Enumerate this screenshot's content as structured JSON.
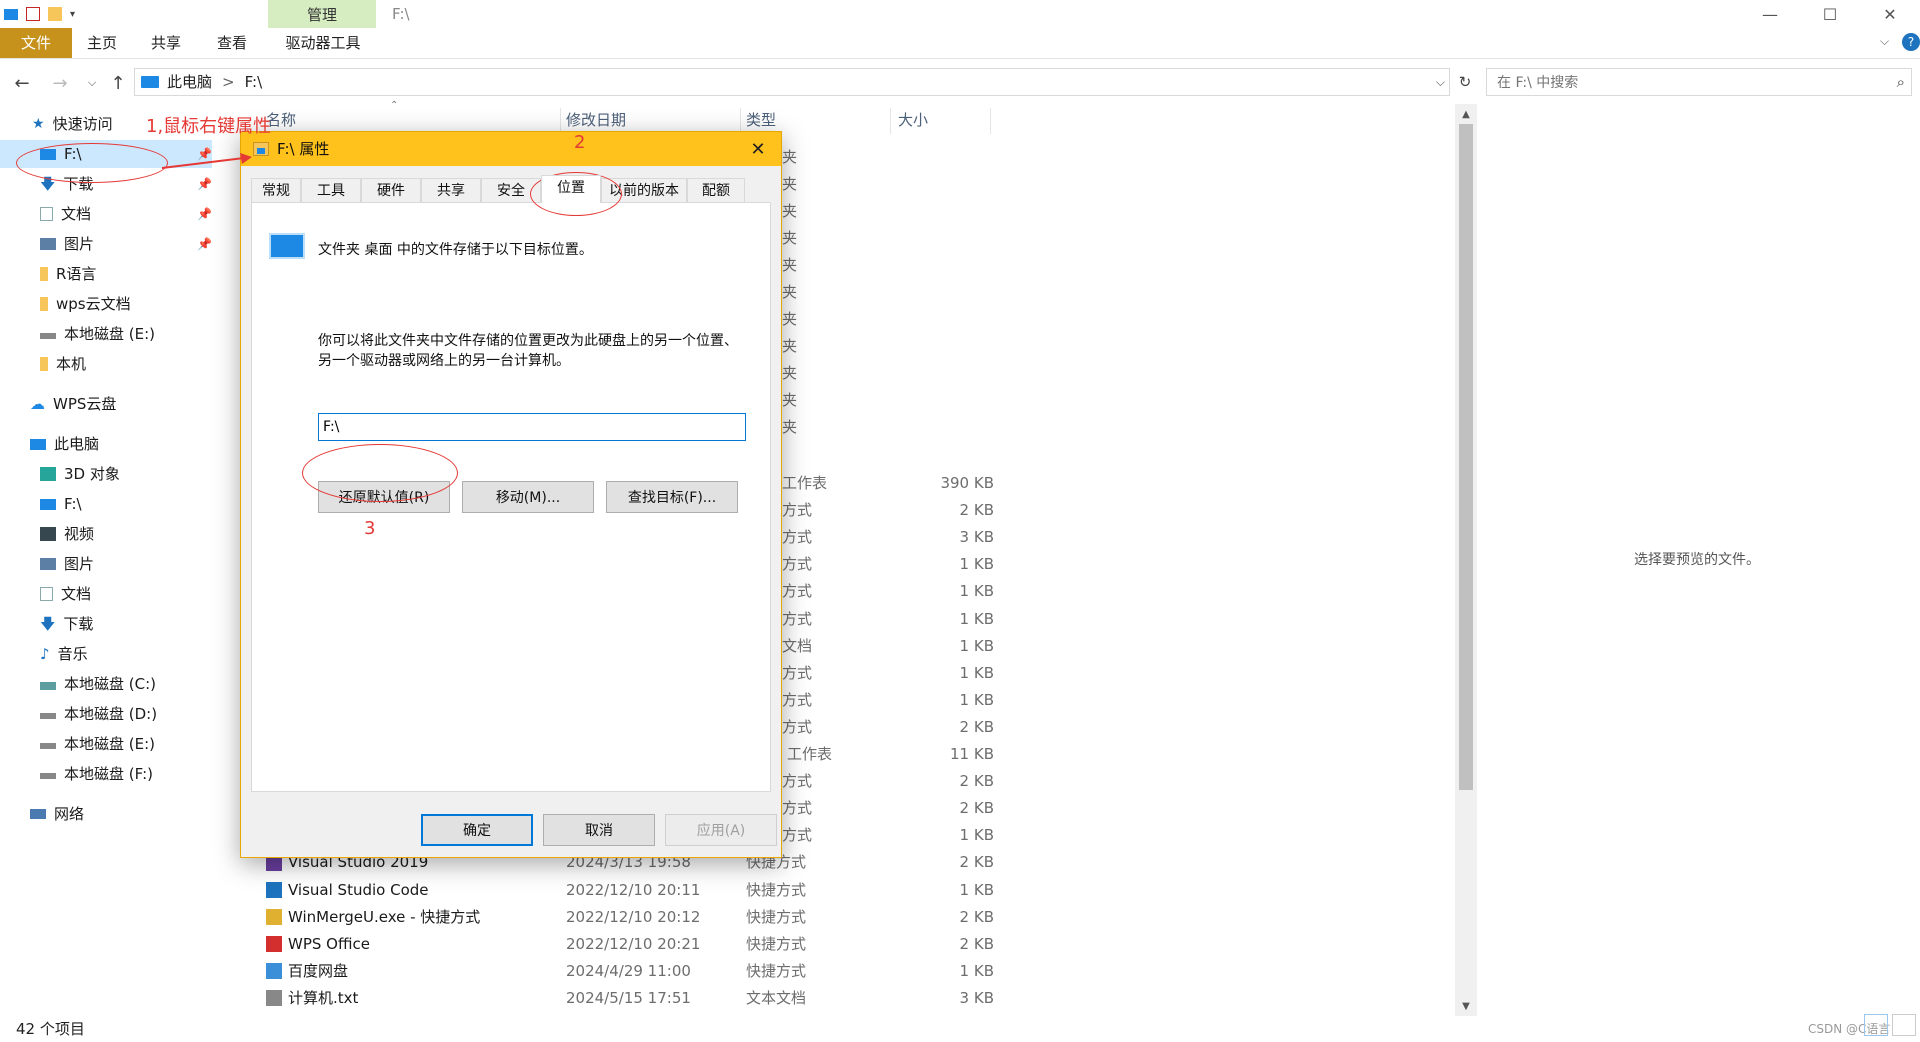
{
  "window": {
    "context_tab": "管理",
    "path": "F:\\",
    "buttons": {
      "minimize": "—",
      "maximize": "☐",
      "close": "✕"
    }
  },
  "ribbon": {
    "tabs": [
      "文件",
      "主页",
      "共享",
      "查看",
      "驱动器工具"
    ]
  },
  "address": {
    "crumbs": [
      "此电脑",
      ">",
      "F:\\"
    ],
    "dropdown": "⌵"
  },
  "search": {
    "placeholder": "在 F:\\ 中搜索"
  },
  "nav": {
    "quick_access": "快速访问",
    "quick_items": [
      "F:\\",
      "下载",
      "文档",
      "图片",
      "R语言",
      "wps云文档",
      "本地磁盘 (E:)",
      "本机"
    ],
    "wps": "WPS云盘",
    "this_pc": "此电脑",
    "pc_items": [
      "3D 对象",
      "F:\\",
      "视频",
      "图片",
      "文档",
      "下载",
      "音乐",
      "本地磁盘 (C:)",
      "本地磁盘 (D:)",
      "本地磁盘 (E:)",
      "本地磁盘 (F:)"
    ],
    "network": "网络"
  },
  "columns": {
    "name": "名称",
    "date": "修改日期",
    "type": "类型",
    "size": "大小"
  },
  "files": [
    {
      "name": "",
      "date": "",
      "type": "工作表",
      "size": "390 KB"
    },
    {
      "name": "",
      "date": "",
      "type": "方式",
      "size": "2 KB"
    },
    {
      "name": "",
      "date": "",
      "type": "方式",
      "size": "3 KB"
    },
    {
      "name": "",
      "date": "",
      "type": "方式",
      "size": "1 KB"
    },
    {
      "name": "",
      "date": "",
      "type": "方式",
      "size": "1 KB"
    },
    {
      "name": "",
      "date": "",
      "type": "方式",
      "size": "1 KB"
    },
    {
      "name": "",
      "date": "",
      "type": "文档",
      "size": "1 KB"
    },
    {
      "name": "",
      "date": "",
      "type": "方式",
      "size": "1 KB"
    },
    {
      "name": "",
      "date": "",
      "type": "方式",
      "size": "1 KB"
    },
    {
      "name": "",
      "date": "",
      "type": "方式",
      "size": "2 KB"
    },
    {
      "name": "",
      "date": "",
      "type": "工作表",
      "size": "11 KB"
    },
    {
      "name": "",
      "date": "",
      "type": "方式",
      "size": "2 KB"
    },
    {
      "name": "",
      "date": "",
      "type": "方式",
      "size": "2 KB"
    },
    {
      "name": "",
      "date": "",
      "type": "方式",
      "size": "1 KB"
    },
    {
      "name": "Visual Studio 2019",
      "date": "2024/3/13 19:58",
      "type": "快捷方式",
      "size": "2 KB"
    },
    {
      "name": "Visual Studio Code",
      "date": "2022/12/10 20:11",
      "type": "快捷方式",
      "size": "1 KB"
    },
    {
      "name": "WinMergeU.exe - 快捷方式",
      "date": "2022/12/10 20:12",
      "type": "快捷方式",
      "size": "2 KB"
    },
    {
      "name": "WPS Office",
      "date": "2022/12/10 20:21",
      "type": "快捷方式",
      "size": "2 KB"
    },
    {
      "name": "百度网盘",
      "date": "2024/4/29 11:00",
      "type": "快捷方式",
      "size": "1 KB"
    },
    {
      "name": "计算机.txt",
      "date": "2024/5/15 17:51",
      "type": "文本文档",
      "size": "3 KB"
    }
  ],
  "partial_column": [
    "夹",
    "夹",
    "夹",
    "夹",
    "夹",
    "夹",
    "夹",
    "夹",
    "夹",
    "夹",
    "夹"
  ],
  "preview": "选择要预览的文件。",
  "status": {
    "count": "42 个项目"
  },
  "watermark": "CSDN @C语言",
  "dialog": {
    "title": "F:\\ 属性",
    "close": "✕",
    "tabs": [
      "常规",
      "工具",
      "硬件",
      "共享",
      "安全",
      "位置",
      "以前的版本",
      "配额"
    ],
    "desc1": "文件夹 桌面 中的文件存储于以下目标位置。",
    "desc2": "你可以将此文件夹中文件存储的位置更改为此硬盘上的另一个位置、另一个驱动器或网络上的另一台计算机。",
    "location": "F:\\",
    "buttons": {
      "restore": "还原默认值(R)",
      "move": "移动(M)...",
      "find": "查找目标(F)...",
      "ok": "确定",
      "cancel": "取消",
      "apply": "应用(A)"
    }
  },
  "annotations": {
    "step1": "1,鼠标右键属性",
    "step2": "2",
    "step3": "3"
  },
  "colors": {
    "accent": "#0078d7",
    "file_tab": "#c7921b",
    "dialog_title": "#ffc21c",
    "annotation": "#e53935",
    "selected": "#cce8ff"
  }
}
